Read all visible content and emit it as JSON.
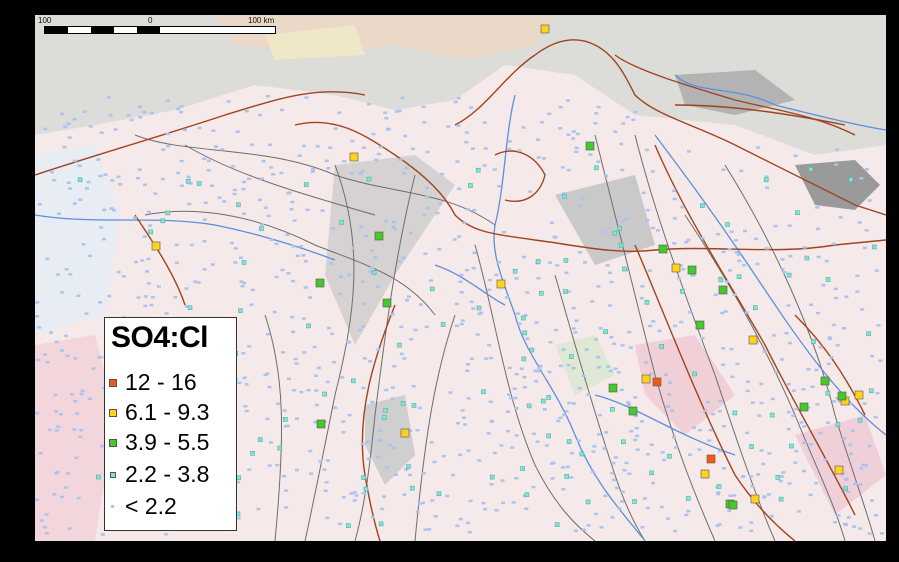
{
  "scale_bar": {
    "labels": [
      "100",
      "0",
      "100 km"
    ]
  },
  "legend": {
    "title": "SO4:Cl",
    "classes": [
      {
        "label": "12 - 16",
        "color": "#f05a14",
        "symbol": "square-large"
      },
      {
        "label": "6.1 - 9.3",
        "color": "#ffd21e",
        "symbol": "square-large"
      },
      {
        "label": "3.9 - 5.5",
        "color": "#46c82d",
        "symbol": "square-large"
      },
      {
        "label": "2.2 - 3.8",
        "color": "#7de8d2",
        "symbol": "square-small"
      },
      {
        "label": "< 2.2",
        "color": "#a9c4ee",
        "symbol": "dot-tiny"
      }
    ]
  },
  "map_colors": {
    "boundary": "#a0441f",
    "river": "#5b8fe0",
    "fault": "#6d6d6d",
    "background": "#f6e9e9"
  }
}
